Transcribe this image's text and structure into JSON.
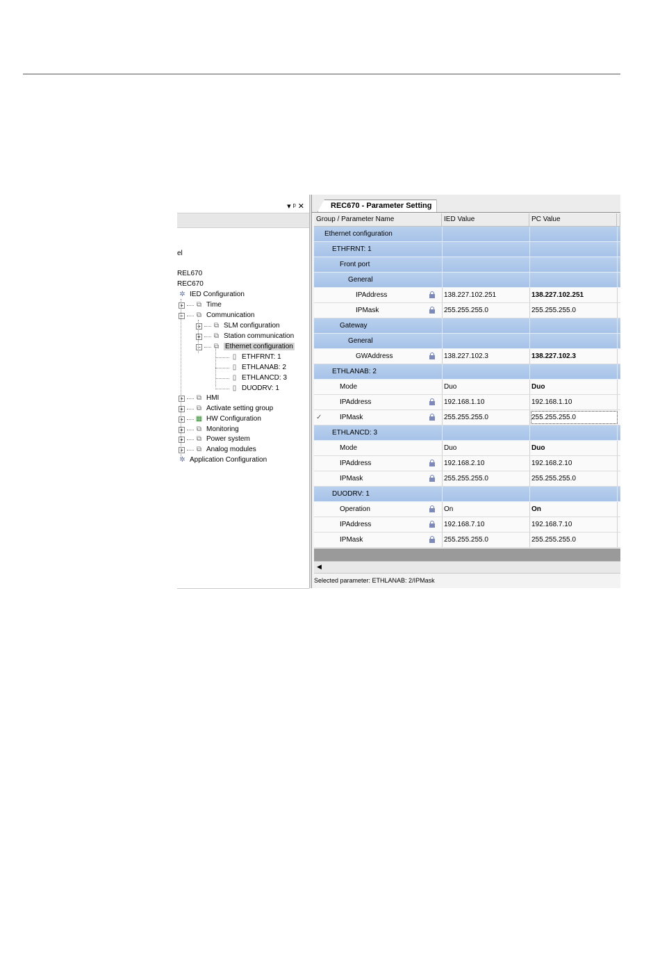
{
  "left_pane": {
    "tree_items": [
      {
        "label": "el"
      },
      {
        "label": "REL670"
      },
      {
        "label": "REC670"
      },
      {
        "label": "IED Configuration",
        "icon": "gear-icon"
      },
      {
        "label": "Time",
        "icon": "function-icon"
      },
      {
        "label": "Communication",
        "icon": "function-icon"
      },
      {
        "label": "SLM configuration",
        "icon": "function-icon"
      },
      {
        "label": "Station communication",
        "icon": "function-icon"
      },
      {
        "label": "Ethernet configuration",
        "icon": "function-icon",
        "selected": true
      },
      {
        "label": "ETHFRNT: 1",
        "icon": "parameter-icon"
      },
      {
        "label": "ETHLANAB: 2",
        "icon": "parameter-icon"
      },
      {
        "label": "ETHLANCD: 3",
        "icon": "parameter-icon"
      },
      {
        "label": "DUODRV: 1",
        "icon": "parameter-icon"
      },
      {
        "label": "HMI",
        "icon": "function-icon"
      },
      {
        "label": "Activate setting group",
        "icon": "function-icon"
      },
      {
        "label": "HW Configuration",
        "icon": "hardware-icon"
      },
      {
        "label": "Monitoring",
        "icon": "function-icon"
      },
      {
        "label": "Power system",
        "icon": "function-icon"
      },
      {
        "label": "Analog modules",
        "icon": "function-icon"
      },
      {
        "label": "Application Configuration",
        "icon": "gear-icon"
      }
    ]
  },
  "tab": {
    "title": "REC670 - Parameter Setting"
  },
  "grid": {
    "columns": [
      "Group / Parameter Name",
      "IED Value",
      "PC Value"
    ],
    "rows": [
      {
        "type": "group",
        "name": "Ethernet configuration"
      },
      {
        "type": "group",
        "name": "ETHFRNT: 1"
      },
      {
        "type": "group",
        "name": "Front port"
      },
      {
        "type": "group",
        "name": "General"
      },
      {
        "type": "param",
        "name": "IPAddress",
        "locked": true,
        "ied": "138.227.102.251",
        "pc": "138.227.102.251",
        "pc_bold": true
      },
      {
        "type": "param",
        "name": "IPMask",
        "locked": true,
        "ied": "255.255.255.0",
        "pc": "255.255.255.0"
      },
      {
        "type": "group",
        "name": "Gateway"
      },
      {
        "type": "group",
        "name": "General"
      },
      {
        "type": "param",
        "name": "GWAddress",
        "locked": true,
        "ied": "138.227.102.3",
        "pc": "138.227.102.3",
        "pc_bold": true
      },
      {
        "type": "group",
        "name": "ETHLANAB: 2"
      },
      {
        "type": "param",
        "name": "Mode",
        "locked": false,
        "ied": "Duo",
        "pc": "Duo",
        "pc_bold": true
      },
      {
        "type": "param",
        "name": "IPAddress",
        "locked": true,
        "ied": "192.168.1.10",
        "pc": "192.168.1.10"
      },
      {
        "type": "param",
        "name": "IPMask",
        "locked": true,
        "ied": "255.255.255.0",
        "pc": "255.255.255.0",
        "editing": true,
        "check": "✓"
      },
      {
        "type": "group",
        "name": "ETHLANCD: 3"
      },
      {
        "type": "param",
        "name": "Mode",
        "locked": false,
        "ied": "Duo",
        "pc": "Duo",
        "pc_bold": true
      },
      {
        "type": "param",
        "name": "IPAddress",
        "locked": true,
        "ied": "192.168.2.10",
        "pc": "192.168.2.10"
      },
      {
        "type": "param",
        "name": "IPMask",
        "locked": true,
        "ied": "255.255.255.0",
        "pc": "255.255.255.0"
      },
      {
        "type": "group",
        "name": "DUODRV: 1"
      },
      {
        "type": "param",
        "name": "Operation",
        "locked": true,
        "ied": "On",
        "pc": "On",
        "pc_bold": true
      },
      {
        "type": "param",
        "name": "IPAddress",
        "locked": true,
        "ied": "192.168.7.10",
        "pc": "192.168.7.10"
      },
      {
        "type": "param",
        "name": "IPMask",
        "locked": true,
        "ied": "255.255.255.0",
        "pc": "255.255.255.0"
      }
    ]
  },
  "status_bar": {
    "text": "Selected parameter: ETHLANAB: 2/IPMask"
  }
}
